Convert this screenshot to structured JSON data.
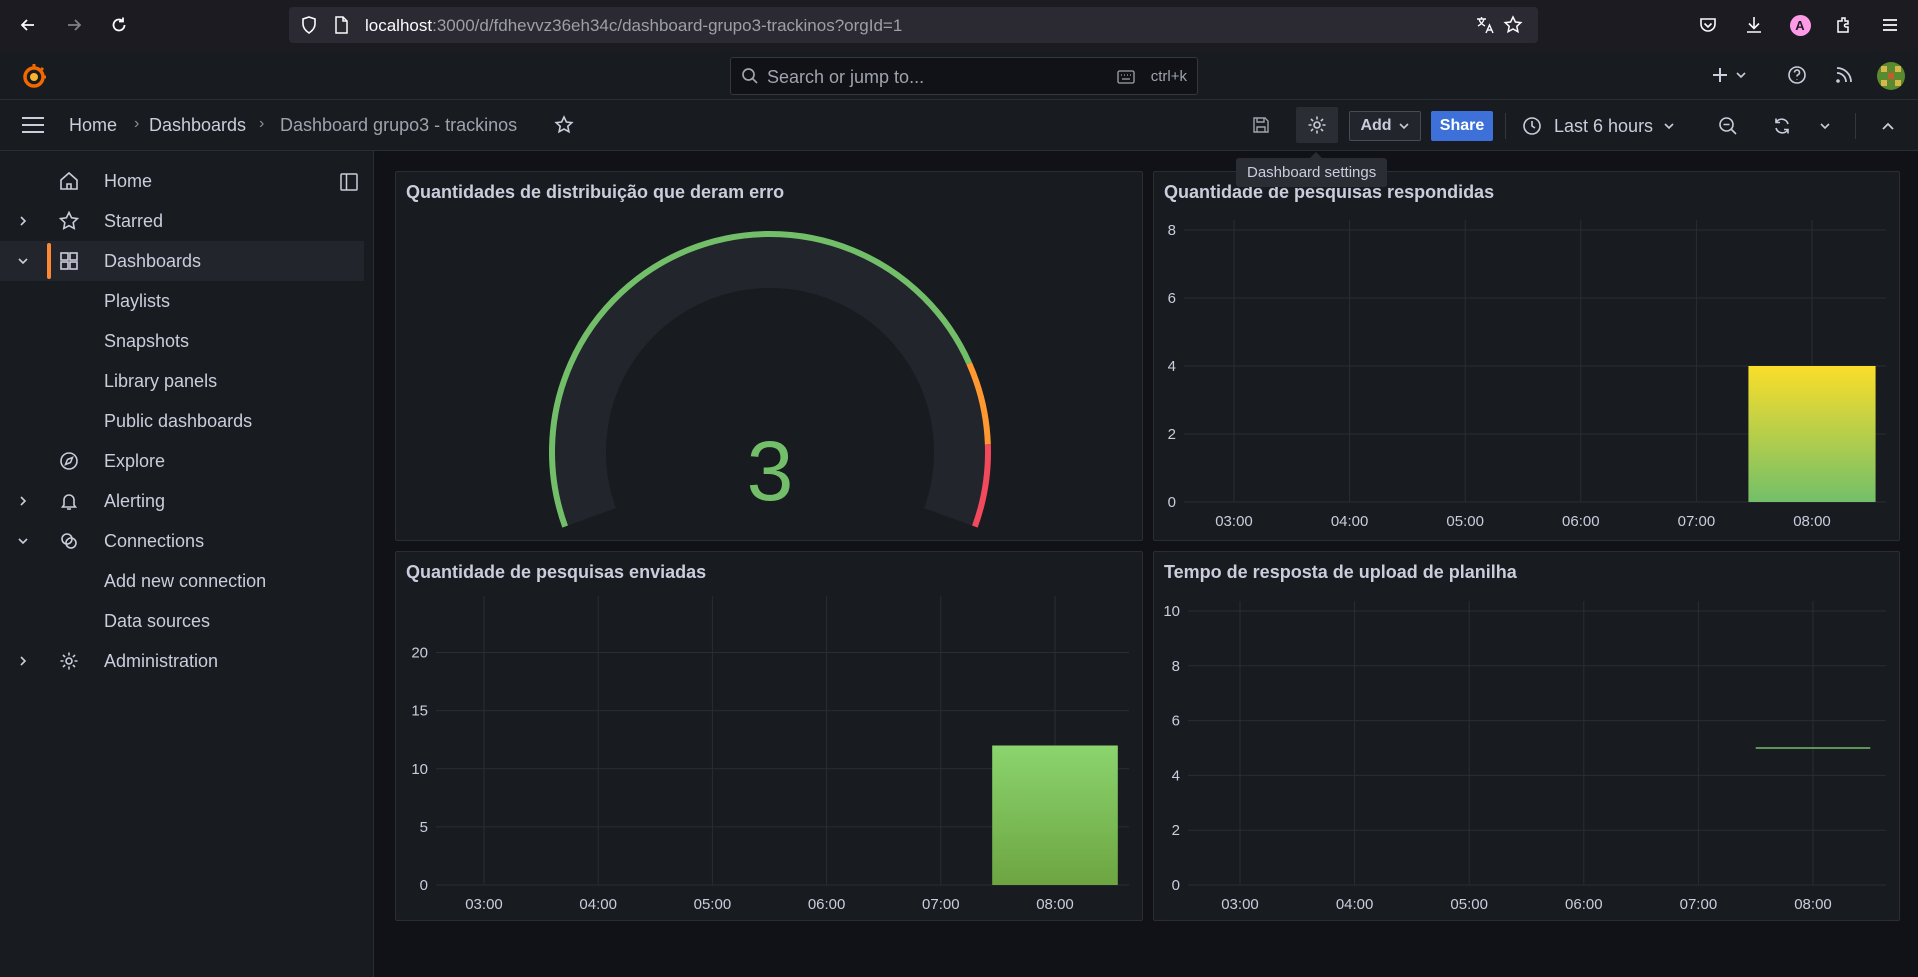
{
  "browser": {
    "url_host": "localhost",
    "url_rest": ":3000/d/fdhevvz36eh34c/dashboard-grupo3-trackinos?orgId=1",
    "avatar_letter": "A"
  },
  "topnav": {
    "search_placeholder": "Search or jump to...",
    "search_shortcut": "ctrl+k"
  },
  "breadcrumb": {
    "items": [
      "Home",
      "Dashboards",
      "Dashboard grupo3 - trackinos"
    ]
  },
  "toolbar": {
    "add_label": "Add",
    "share_label": "Share",
    "time_range": "Last 6 hours",
    "tooltip": "Dashboard settings"
  },
  "sidebar": {
    "items": [
      {
        "label": "Home"
      },
      {
        "label": "Starred"
      },
      {
        "label": "Dashboards"
      },
      {
        "label": "Playlists"
      },
      {
        "label": "Snapshots"
      },
      {
        "label": "Library panels"
      },
      {
        "label": "Public dashboards"
      },
      {
        "label": "Explore"
      },
      {
        "label": "Alerting"
      },
      {
        "label": "Connections"
      },
      {
        "label": "Add new connection"
      },
      {
        "label": "Data sources"
      },
      {
        "label": "Administration"
      }
    ]
  },
  "colors": {
    "accent": "#ff8833",
    "share_blue": "#3d71d9",
    "gauge_green": "#73bf69",
    "gauge_orange": "#ff9830",
    "gauge_red": "#f2495c",
    "bar_yellow": "#fade2a"
  },
  "panels": {
    "gauge": {
      "title": "Quantidades de distribuição que deram erro",
      "value": "3"
    },
    "respondidas": {
      "title": "Quantidade de pesquisas respondidas"
    },
    "enviadas": {
      "title": "Quantidade de pesquisas enviadas"
    },
    "tempo": {
      "title": "Tempo de resposta de upload de planilha"
    }
  },
  "chart_data": [
    {
      "type": "gauge",
      "title": "Quantidades de distribuição que deram erro",
      "value": 3,
      "thresholds": [
        {
          "color": "green",
          "from": 0
        },
        {
          "color": "orange",
          "from": 0.8
        },
        {
          "color": "red",
          "from": 0.9
        }
      ]
    },
    {
      "type": "bar",
      "title": "Quantidade de pesquisas respondidas",
      "x_ticks": [
        "03:00",
        "04:00",
        "05:00",
        "06:00",
        "07:00",
        "08:00"
      ],
      "y_ticks": [
        0,
        2,
        4,
        6,
        8
      ],
      "ylim": [
        0,
        8
      ],
      "bars": [
        {
          "x": "08:00",
          "value": 4
        }
      ],
      "grid": true
    },
    {
      "type": "bar",
      "title": "Quantidade de pesquisas enviadas",
      "x_ticks": [
        "03:00",
        "04:00",
        "05:00",
        "06:00",
        "07:00",
        "08:00"
      ],
      "y_ticks": [
        0,
        5,
        10,
        15,
        20
      ],
      "ylim": [
        0,
        24
      ],
      "bars": [
        {
          "x": "08:00",
          "value": 12
        }
      ],
      "grid": true
    },
    {
      "type": "line",
      "title": "Tempo de resposta de upload de planilha",
      "x_ticks": [
        "03:00",
        "04:00",
        "05:00",
        "06:00",
        "07:00",
        "08:00"
      ],
      "y_ticks": [
        0,
        2,
        4,
        6,
        8,
        10
      ],
      "ylim": [
        0,
        10
      ],
      "points": [
        {
          "x": "07:30",
          "y": 5
        },
        {
          "x": "08:30",
          "y": 5
        }
      ],
      "grid": true
    }
  ]
}
